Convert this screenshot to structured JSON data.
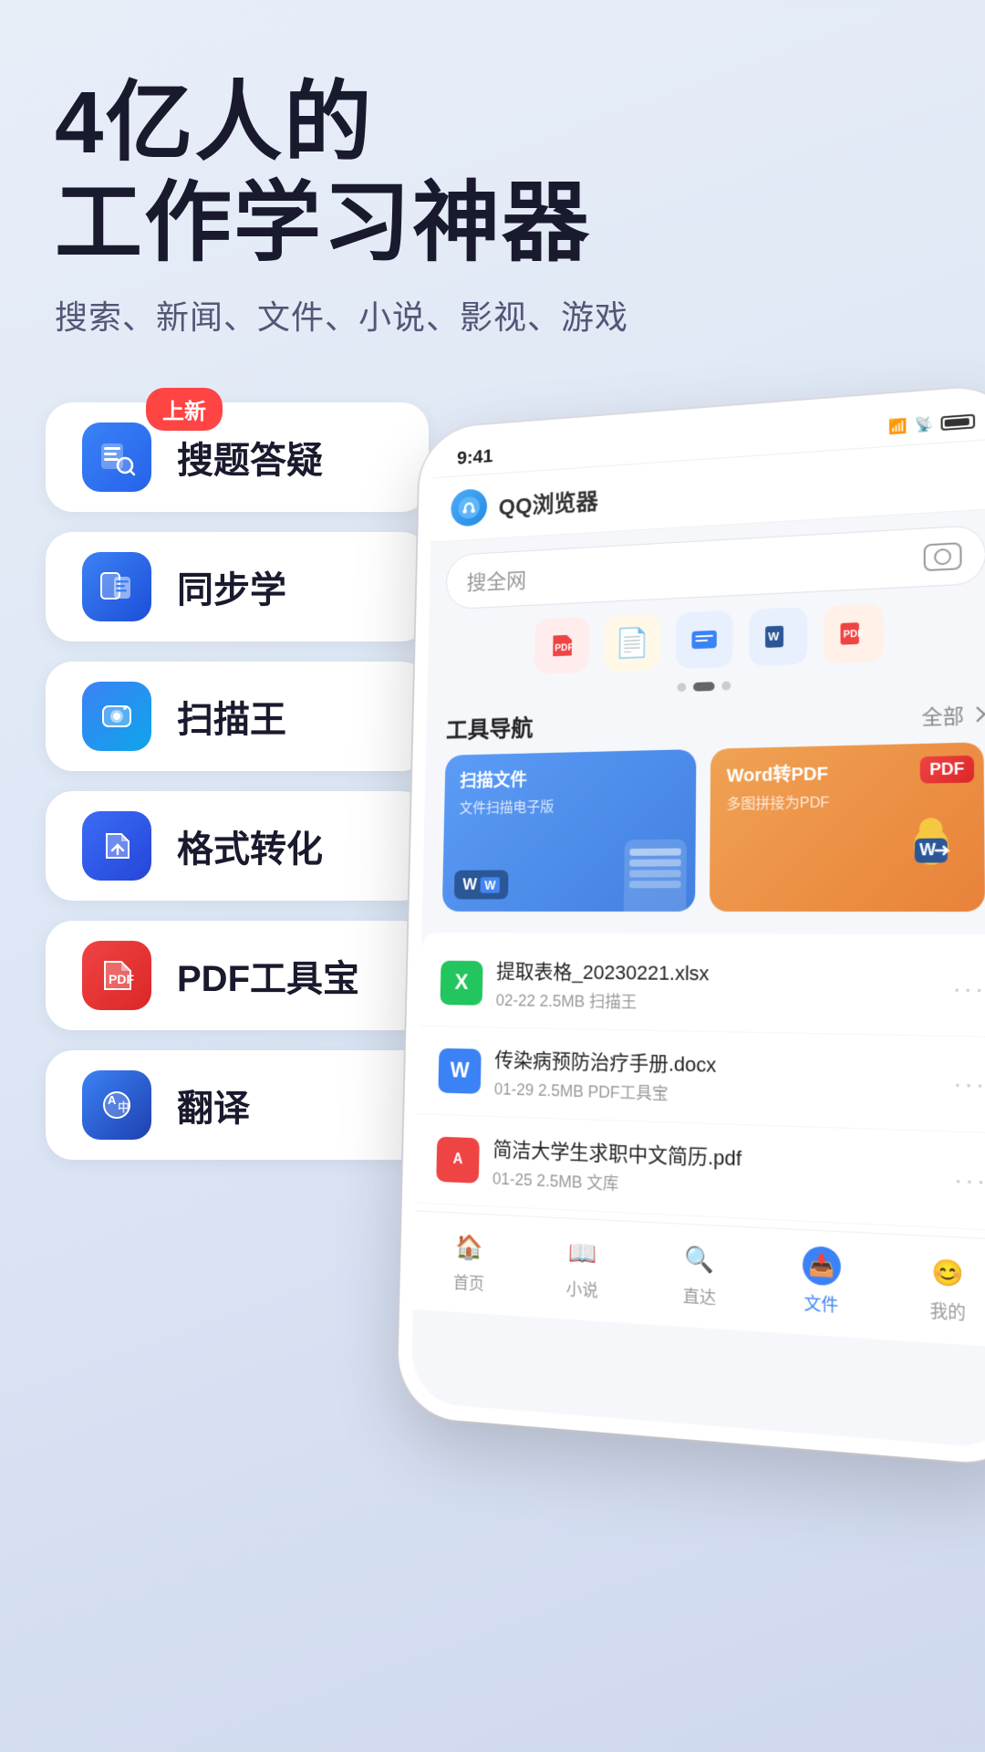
{
  "hero": {
    "title_line1": "4亿人的",
    "title_line2": "工作学习神器",
    "subtitle": "搜索、新闻、文件、小说、影视、游戏"
  },
  "badge": {
    "new_label": "上新"
  },
  "features": [
    {
      "id": "search-qa",
      "label": "搜题答疑",
      "icon_type": "search-qa",
      "has_badge": true
    },
    {
      "id": "sync-learn",
      "label": "同步学",
      "icon_type": "sync",
      "has_badge": false
    },
    {
      "id": "scan-king",
      "label": "扫描王",
      "icon_type": "scan",
      "has_badge": false
    },
    {
      "id": "format-convert",
      "label": "格式转化",
      "icon_type": "convert",
      "has_badge": false
    },
    {
      "id": "pdf-tools",
      "label": "PDF工具宝",
      "icon_type": "pdf",
      "has_badge": false
    },
    {
      "id": "translate",
      "label": "翻译",
      "icon_type": "translate",
      "has_badge": false
    }
  ],
  "phone": {
    "time": "9:41",
    "app_name": "QQ浏览器",
    "search_placeholder": "搜全网",
    "tool_nav_title": "工具导航",
    "tool_nav_all": "全部",
    "tool_cards": [
      {
        "id": "scan-file",
        "title": "扫描文件",
        "subtitle": "文件扫描电子版",
        "color": "blue"
      },
      {
        "id": "word-to-pdf",
        "title": "Word转PDF",
        "subtitle": "多图拼接为PDF",
        "color": "orange"
      }
    ],
    "files": [
      {
        "id": "file1",
        "name": "提取表格_20230221.xlsx",
        "meta": "02-22  2.5MB  扫描王",
        "icon_type": "excel"
      },
      {
        "id": "file2",
        "name": "传染病预防治疗手册.docx",
        "meta": "01-29  2.5MB  PDF工具宝",
        "icon_type": "word"
      },
      {
        "id": "file3",
        "name": "简洁大学生求职中文简历.pdf",
        "meta": "01-25  2.5MB  文库",
        "icon_type": "pdf"
      }
    ],
    "nav": [
      {
        "id": "home",
        "label": "首页",
        "icon": "🏠",
        "active": false
      },
      {
        "id": "novel",
        "label": "小说",
        "icon": "📖",
        "active": false
      },
      {
        "id": "direct",
        "label": "直达",
        "icon": "🔍",
        "active": false
      },
      {
        "id": "files",
        "label": "文件",
        "icon": "📥",
        "active": true
      },
      {
        "id": "mine",
        "label": "我的",
        "icon": "😊",
        "active": false
      }
    ]
  }
}
